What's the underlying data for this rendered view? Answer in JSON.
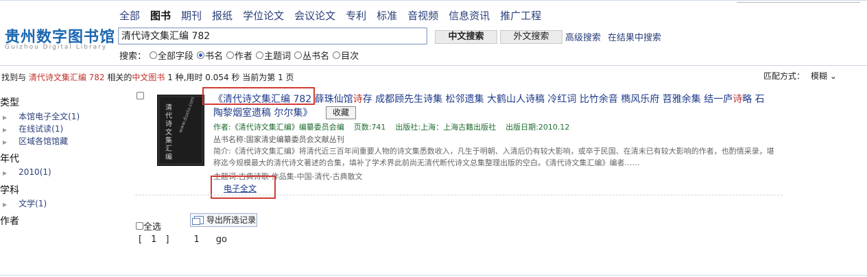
{
  "logo": {
    "cn": "贵州数字图书馆",
    "en": "Guizhou Digital Library"
  },
  "tabs": [
    "全部",
    "图书",
    "期刊",
    "报纸",
    "学位论文",
    "会议论文",
    "专利",
    "标准",
    "音视频",
    "信息资讯",
    "推广工程"
  ],
  "active_tab": "图书",
  "search": {
    "value": "清代诗文集汇编 782",
    "btn_cn": "中文搜索",
    "btn_foreign": "外文搜索",
    "advanced": "高级搜索",
    "in_results": "在结果中搜索",
    "options_label": "搜索：",
    "options": [
      "全部字段",
      "书名",
      "作者",
      "主题词",
      "丛书名",
      "目次"
    ],
    "selected_option": "书名"
  },
  "summary": {
    "p1": "找到与 ",
    "query": "清代诗文集汇编 782",
    "p2": " 相关的",
    "type": "中文图书",
    "p3": " 1 种,用时 0.054 秒 当前为第 1 页"
  },
  "match": {
    "label": "匹配方式：",
    "value": "模糊 ⌄"
  },
  "sidebar": {
    "type_head": "类型",
    "type_items": [
      "本馆电子全文(1)",
      "在线试读(1)",
      "区域各馆馆藏"
    ],
    "year_head": "年代",
    "year_items": [
      "2010(1)"
    ],
    "subject_head": "学科",
    "subject_items": [
      "文学(1)"
    ],
    "author_head": "作者"
  },
  "result": {
    "title_a": "《清代诗文集汇编 782",
    "title_b": " 薛珠仙馆",
    "title_red": "诗",
    "title_c": "存 成都顾先生诗集 松邻遗集 大鹤山人诗稿 冷红词 比竹余音 檇风乐府 苕雅余集 结一庐",
    "title_red2": "诗",
    "title_d": "略 石",
    "title_line2": "陶黎烟室遗稿 尔尔集》",
    "fav": "收藏",
    "author": "作者:《清代诗文集汇编》编纂委员会编",
    "pages": "页数:741",
    "publisher": "出版社:上海：上海古籍出版社",
    "date": "出版日期:2010.12",
    "series": "丛书名称:国家清史编纂委员会文献丛刊",
    "desc": "简介:《清代诗文集汇编》将清代近三百年间重要人物的诗文集悉数收入，凡生于明朝、入清后仍有较大影响，或卒于民国、在清末已有较大影响的作者，也酌情采录，堪称迄今规模最大的清代诗文著述的合集，填补了学术界此前尚无清代断代诗文总集整理出版的空白。《清代诗文集汇编》编者……",
    "subject": "主题词:古典诗歌-作品集-中国-清代-古典散文",
    "fulltext": "电子全文",
    "cover_title": "清代诗文集汇编",
    "cover_url": "www.duxiu.com"
  },
  "footer": {
    "select_all": "全选",
    "export": "导出所选记录",
    "pager_open": "[",
    "pager_current": "1",
    "pager_close": "]",
    "pager_page": "1",
    "pager_go": "go"
  }
}
